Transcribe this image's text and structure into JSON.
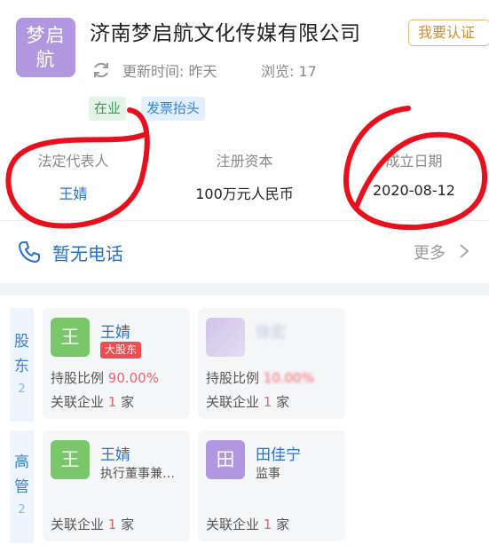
{
  "company": {
    "logo_lines": [
      "梦启",
      "航"
    ],
    "name": "济南梦启航文化传媒有限公司",
    "certify_label": "我要认证",
    "update_label": "更新时间: 昨天",
    "views_label": "浏览: 17",
    "tags": [
      "在业",
      "发票抬头"
    ]
  },
  "info": {
    "legal_rep_label": "法定代表人",
    "legal_rep_value": "王婧",
    "capital_label": "注册资本",
    "capital_value": "100万元人民币",
    "founded_label": "成立日期",
    "founded_value": "2020-08-12"
  },
  "phone": {
    "text": "暂无电话",
    "more_label": "更多"
  },
  "shareholders": {
    "side_chars": [
      "股",
      "东"
    ],
    "count": "2",
    "cards": [
      {
        "avatar": "王",
        "name": "王婧",
        "badge": "大股东",
        "ratio_label": "持股比例 ",
        "ratio": "90.00%",
        "related_label": "关联企业 ",
        "related_count": "1",
        "related_unit": " 家"
      },
      {
        "avatar": "",
        "name": "徐宏",
        "ratio_label": "持股比例 ",
        "ratio": "10.00%",
        "related_label": "关联企业 ",
        "related_count": "1",
        "related_unit": " 家"
      }
    ]
  },
  "managers": {
    "side_chars": [
      "高",
      "管"
    ],
    "count": "2",
    "cards": [
      {
        "avatar": "王",
        "name": "王婧",
        "role": "执行董事兼…",
        "related_label": "关联企业 ",
        "related_count": "1",
        "related_unit": " 家"
      },
      {
        "avatar": "田",
        "name": "田佳宁",
        "role": "监事",
        "related_label": "关联企业 ",
        "related_count": "1",
        "related_unit": " 家"
      }
    ]
  },
  "colors": {
    "link_blue": "#2a6fc8",
    "red_value": "#f0606d",
    "annotation_red": "#e8101c",
    "logo_purple": "#b197e0",
    "avatar_green": "#7ac76b"
  }
}
